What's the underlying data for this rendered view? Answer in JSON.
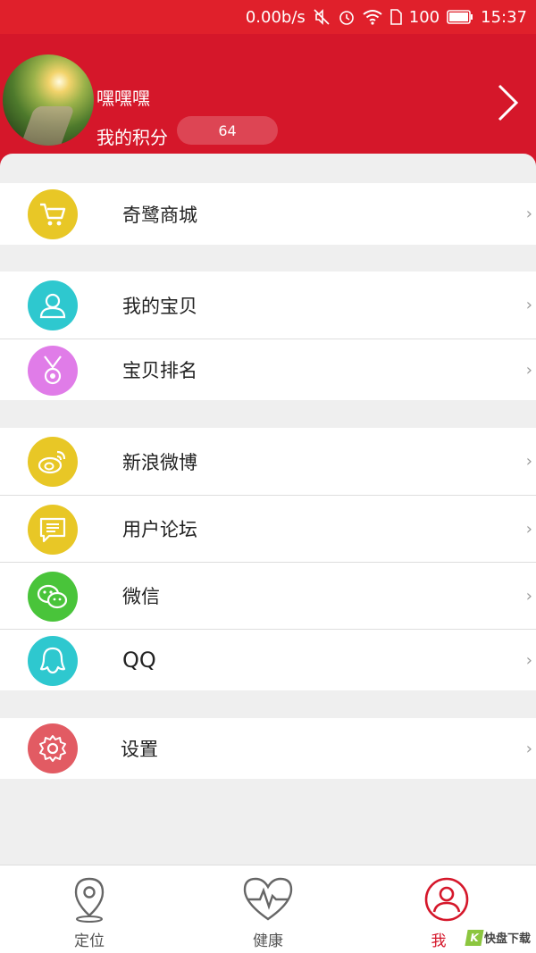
{
  "status_bar": {
    "net_speed": "0.00b/s",
    "battery": "100",
    "time": "15:37"
  },
  "profile": {
    "name": "嘿嘿嘿",
    "points_label": "我的积分",
    "points_value": "64"
  },
  "menu": {
    "group1": [
      {
        "label": "奇鹭商城",
        "icon": "cart-icon",
        "color": "#e8c726"
      }
    ],
    "group2": [
      {
        "label": "我的宝贝",
        "icon": "user-icon",
        "color": "#2ec8cf"
      },
      {
        "label": "宝贝排名",
        "icon": "medal-icon",
        "color": "#e07ce8"
      }
    ],
    "group3": [
      {
        "label": "新浪微博",
        "icon": "weibo-icon",
        "color": "#e8c726"
      },
      {
        "label": "用户论坛",
        "icon": "forum-icon",
        "color": "#e8c726"
      },
      {
        "label": "微信",
        "icon": "wechat-icon",
        "color": "#49c43a"
      },
      {
        "label": "QQ",
        "icon": "qq-icon",
        "color": "#2ec8cf"
      }
    ],
    "group4": [
      {
        "label": "设置",
        "icon": "settings-icon",
        "color": "#e25b63"
      }
    ]
  },
  "tabbar": {
    "tabs": [
      {
        "label": "定位",
        "icon": "location-pin-icon"
      },
      {
        "label": "健康",
        "icon": "heart-pulse-icon"
      },
      {
        "label": "我",
        "icon": "profile-icon",
        "active": true
      }
    ]
  },
  "watermark": {
    "k": "K",
    "text": "快盘下载"
  },
  "colors": {
    "accent": "#d5172a",
    "status_bar": "#e0202b"
  }
}
